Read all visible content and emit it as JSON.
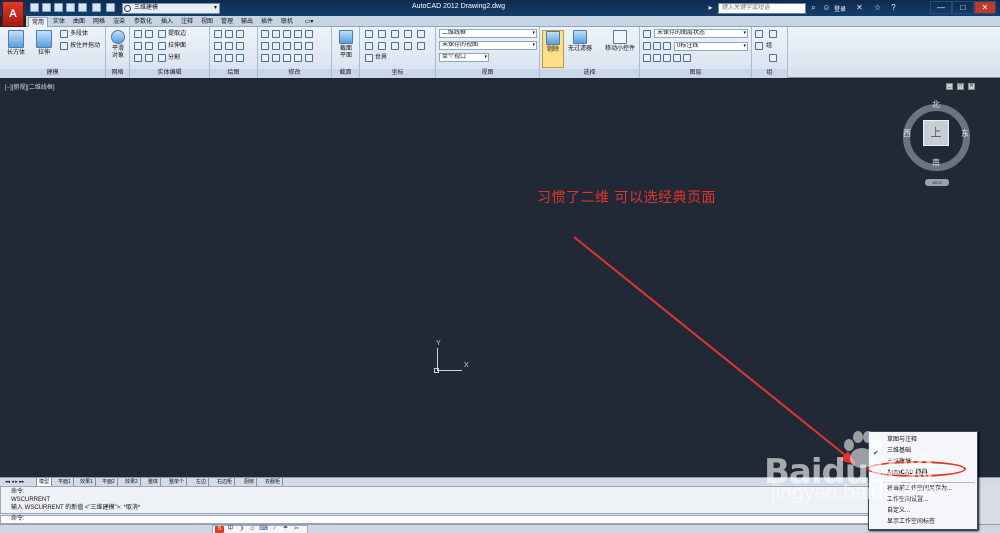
{
  "titlebar": {
    "app_logo": "A",
    "workspace": "三维建模",
    "title": "AutoCAD 2012    Drawing2.dwg",
    "search_placeholder": "键入关键字或短语",
    "login": "登录",
    "minimize": "—",
    "restore": "□",
    "close": "✕"
  },
  "tabs": [
    "常用",
    "实体",
    "曲面",
    "网格",
    "渲染",
    "参数化",
    "插入",
    "注释",
    "视图",
    "管理",
    "输出",
    "插件",
    "联机",
    "▭▾"
  ],
  "ribbon": {
    "modeling": {
      "label": "建模",
      "box": "长方体",
      "extrude": "拉伸",
      "polysolid": "多段体",
      "presspull": "按住并拖动"
    },
    "mesh": {
      "label": "网格",
      "smooth_object": "平滑\n对象"
    },
    "solid_edit": {
      "label": "实体编辑",
      "extract_edges": "提取边",
      "extrude_faces": "拉伸面",
      "separate": "分割"
    },
    "draw": {
      "label": "绘图"
    },
    "modify": {
      "label": "修改"
    },
    "section": {
      "label": "截面",
      "section_plane": "截面\n平面"
    },
    "coordinates": {
      "label": "坐标",
      "world": "世界"
    },
    "view": {
      "label": "视图",
      "visual_style": "二维线框",
      "unsaved_view": "未保存的视图",
      "single_viewport": "单个视口"
    },
    "selection": {
      "label": "选择",
      "culling": "剔除",
      "no_filter": "无过滤器",
      "gizmo": "移动小控件"
    },
    "layers": {
      "label": "图层",
      "layer_state": "未保存的图层状态",
      "layer_name": "0标注线"
    },
    "groups": {
      "label": "组",
      "group": "组"
    }
  },
  "canvas": {
    "view_label": "[−][俯视][二维线框]",
    "ctl_min": "_",
    "ctl_max": "□",
    "ctl_close": "✕",
    "viewcube": {
      "north": "北",
      "south": "南",
      "east": "东",
      "west": "西",
      "face": "上",
      "wcs": "WCS"
    },
    "ucs": {
      "x": "X",
      "y": "Y"
    },
    "annotation": "习惯了二维  可以选经典页面"
  },
  "layout_tabs": [
    "模型",
    "平面1",
    "效果1",
    "平面2",
    "效果2",
    "整体",
    "整单个",
    "左边",
    "右边柜",
    "厨房",
    "衣服柜"
  ],
  "command": {
    "history": [
      "命令:",
      "WSCURRENT",
      "输入 WSCURRENT 的新值 <\"三维建模\">: *取消*"
    ],
    "prompt": "命令:"
  },
  "ime": [
    "S",
    "中",
    "❩",
    "☺",
    "⌨",
    "♂",
    "☂",
    "✂"
  ],
  "workspace_menu": {
    "items": [
      "草图与注释",
      "三维基础",
      "三维建模",
      "AutoCAD 经典",
      "将当前工作空间另存为...",
      "工作空间设置...",
      "自定义...",
      "显示工作空间标签"
    ],
    "checked": "✔"
  },
  "watermark": {
    "brand": "Baidu经验",
    "url": "jingyan.baidu.com"
  }
}
